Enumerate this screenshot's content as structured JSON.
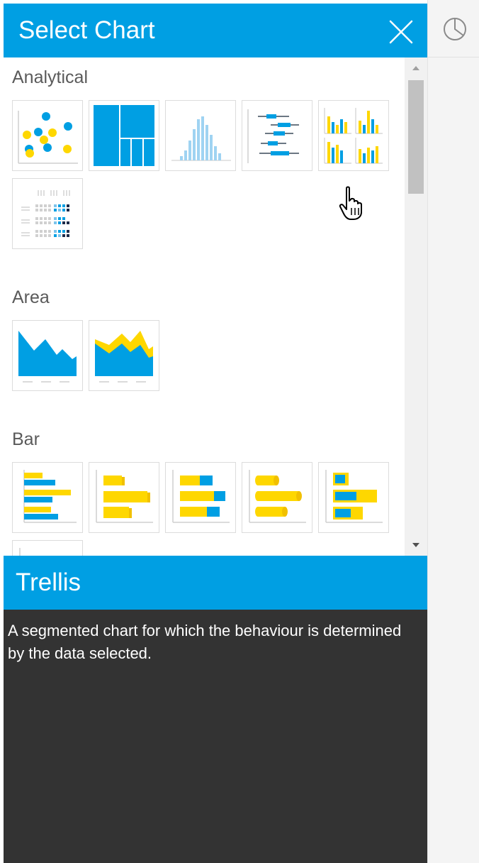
{
  "header": {
    "title": "Select Chart",
    "close_icon": "close-icon"
  },
  "sections": [
    {
      "label": "Analytical",
      "items": [
        "scatter-chart-icon",
        "treemap-chart-icon",
        "histogram-chart-icon",
        "box-plot-chart-icon",
        "trellis-chart-icon",
        "heatmap-chart-icon"
      ]
    },
    {
      "label": "Area",
      "items": [
        "area-chart-icon",
        "stacked-area-chart-icon"
      ]
    },
    {
      "label": "Bar",
      "items": [
        "bar-chart-icon",
        "bar-chart-3d-icon",
        "stacked-bar-chart-icon",
        "cylinder-bar-chart-icon",
        "stacked-bar-chart-alt-icon"
      ]
    }
  ],
  "hovered_item": "trellis-chart-icon",
  "info": {
    "title": "Trellis",
    "description": "A segmented chart for which the behaviour is determined by the data selected."
  },
  "right_panel": {
    "icon": "pie-chart-icon"
  },
  "colors": {
    "accent": "#009fe3",
    "highlight": "#fed700",
    "info_bg": "#333333"
  }
}
